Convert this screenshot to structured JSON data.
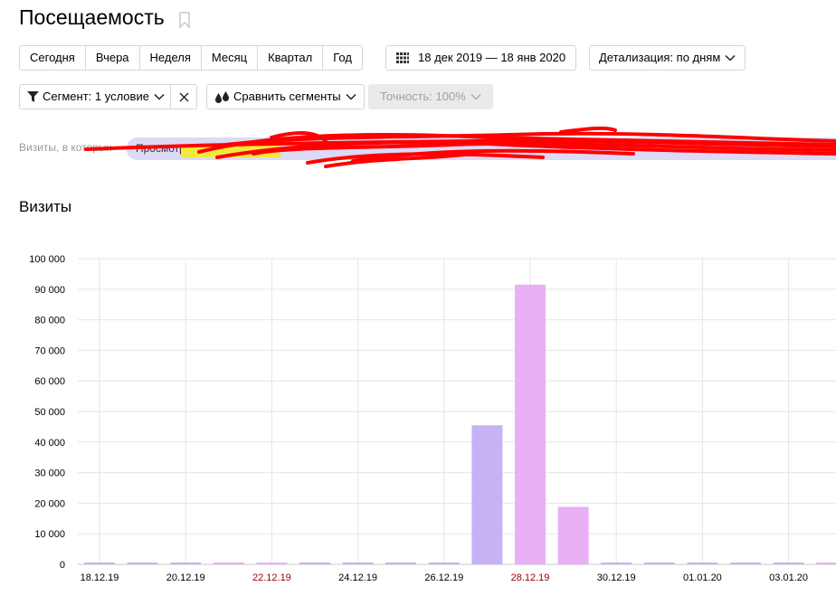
{
  "header": {
    "title": "Посещаемость"
  },
  "period_buttons": [
    "Сегодня",
    "Вчера",
    "Неделя",
    "Месяц",
    "Квартал",
    "Год"
  ],
  "date_range": {
    "label": "18 дек 2019 — 18 янв 2020"
  },
  "detail": {
    "label": "Детализация: по дням"
  },
  "segment": {
    "label": "Сегмент: 1 условие"
  },
  "compare": {
    "label": "Сравнить сегменты"
  },
  "accuracy": {
    "label": "Точность: 100%"
  },
  "segment_row": {
    "label": "Визиты, в которых",
    "condition_text": "Просмотр"
  },
  "section": {
    "title": "Визиты"
  },
  "colors": {
    "bar_primary": "#c5b3f5",
    "bar_secondary": "#e9b0f5",
    "weekend_label": "#a00000",
    "scribble": "#ff0000",
    "highlight": "#f1ea3c"
  },
  "chart_data": {
    "type": "bar",
    "y_ticks": [
      "100 000",
      "90 000",
      "80 000",
      "70 000",
      "60 000",
      "50 000",
      "40 000",
      "30 000",
      "20 000",
      "10 000",
      "0"
    ],
    "ylim": [
      0,
      100000
    ],
    "x_tick_labels": [
      {
        "label": "18.12.19",
        "weekend": false
      },
      {
        "label": "20.12.19",
        "weekend": false
      },
      {
        "label": "22.12.19",
        "weekend": true
      },
      {
        "label": "24.12.19",
        "weekend": false
      },
      {
        "label": "26.12.19",
        "weekend": false
      },
      {
        "label": "28.12.19",
        "weekend": true
      },
      {
        "label": "30.12.19",
        "weekend": false
      },
      {
        "label": "01.01.20",
        "weekend": false
      },
      {
        "label": "03.01.20",
        "weekend": false
      }
    ],
    "categories": [
      "18.12.19",
      "19.12.19",
      "20.12.19",
      "21.12.19",
      "22.12.19",
      "23.12.19",
      "24.12.19",
      "25.12.19",
      "26.12.19",
      "27.12.19",
      "28.12.19",
      "29.12.19",
      "30.12.19",
      "31.12.19",
      "01.01.20",
      "02.01.20",
      "03.01.20",
      "04.01.20"
    ],
    "values": [
      300,
      300,
      300,
      300,
      300,
      300,
      300,
      300,
      300,
      45500,
      91500,
      18800,
      300,
      300,
      300,
      300,
      300,
      300
    ],
    "bar_color_keys": [
      "primary",
      "primary",
      "primary",
      "secondary",
      "secondary",
      "primary",
      "primary",
      "primary",
      "primary",
      "primary",
      "secondary",
      "secondary",
      "primary",
      "primary",
      "primary",
      "primary",
      "primary",
      "secondary"
    ],
    "grid": true
  }
}
